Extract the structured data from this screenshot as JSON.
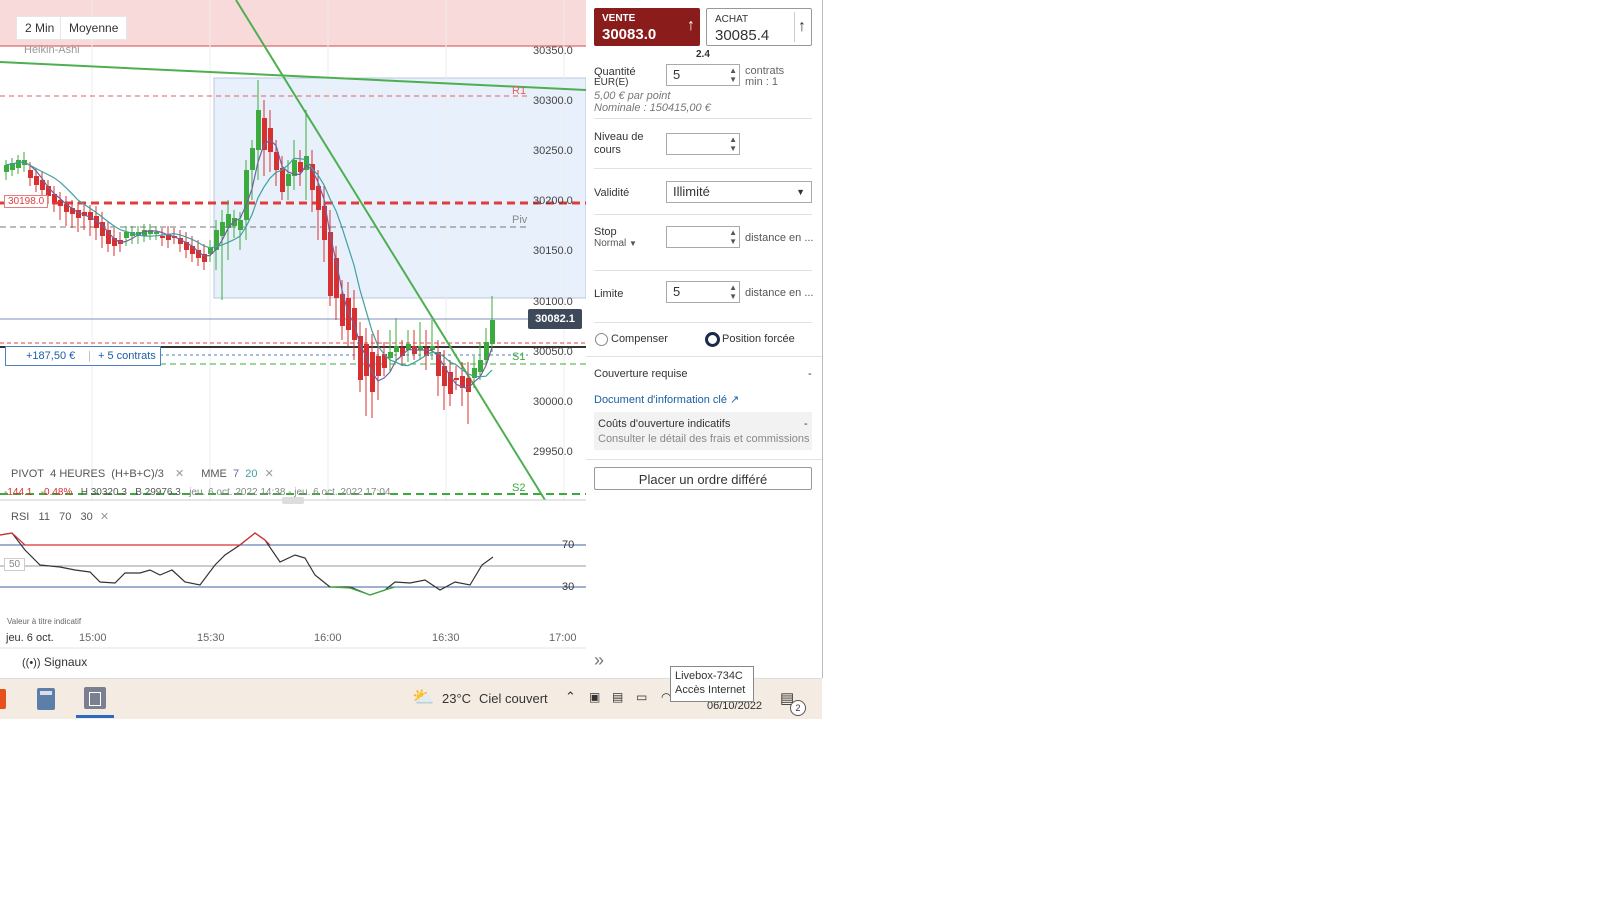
{
  "toolbar": {
    "timeframe": "2 Min",
    "average": "Moyenne",
    "chart_style": "Heikin-Ashi"
  },
  "chart": {
    "price_axis": [
      "30350.0",
      "30300.0",
      "30250.0",
      "30200.0",
      "30150.0",
      "30100.0",
      "30050.0",
      "30000.0",
      "29950.0"
    ],
    "current_price_tag": "30082.1",
    "level_tag": "30198.0",
    "level_labels": {
      "r1": "R1",
      "piv": "Piv",
      "s1": "S1",
      "s2": "S2"
    },
    "position_pnl": "+187,50 €",
    "position_contracts": "+ 5 contrats",
    "indicator_line1": {
      "pivot": "PIVOT",
      "period": "4 HEURES",
      "formula": "(H+B+C)/3",
      "mme": "MME",
      "mme_a": "7",
      "mme_b": "20"
    },
    "stats": {
      "change": "-144.1",
      "change_pct": "-0.48%",
      "high": "H 30320.3",
      "low": "B 29976.3",
      "range": "jeu. 6 oct. 2022 14:38 - jeu. 6 oct. 2022 17:04"
    },
    "rsi": {
      "label": "RSI",
      "p1": "11",
      "p2": "70",
      "p3": "30",
      "level_70": "70",
      "level_50": "50",
      "level_30": "30"
    },
    "disclaimer": "Valeur à titre indicatif",
    "time_axis": [
      "jeu. 6 oct.",
      "15:00",
      "15:30",
      "16:00",
      "16:30",
      "17:00"
    ],
    "signals": "Signaux"
  },
  "panel": {
    "sell_label": "VENTE",
    "sell_price": "30083.0",
    "buy_label": "ACHAT",
    "buy_price": "30085.4",
    "spread": "2.4",
    "quantity_label": "Quantité",
    "quantity_unit": "EUR(E)",
    "quantity_value": "5",
    "contracts_note": "contrats",
    "min_note": "min : 1",
    "per_point": "5,00 € par point",
    "nominal": "Nominale : 150415,00 €",
    "level_label": "Niveau de cours",
    "validity_label": "Validité",
    "validity_value": "Illimité",
    "stop_label": "Stop",
    "stop_type": "Normal",
    "stop_distance": "distance en ...",
    "limit_label": "Limite",
    "limit_value": "5",
    "limit_distance": "distance en ...",
    "radio_compensate": "Compenser",
    "radio_forced": "Position forcée",
    "margin_label": "Couverture requise",
    "margin_value": "-",
    "kid_link": "Document d'information clé",
    "costs_label": "Coûts d'ouverture indicatifs",
    "costs_value": "-",
    "costs_detail": "Consulter le détail des frais et commissions",
    "place_order": "Placer un ordre différé"
  },
  "taskbar": {
    "temperature": "23°C",
    "weather": "Ciel couvert",
    "date": "06/10/2022",
    "notif_count": "2",
    "tooltip_line1": "Livebox-734C",
    "tooltip_line2": "Accès Internet"
  },
  "colors": {
    "sell": "#8b1c1c",
    "up": "#3caa3c",
    "down": "#d83030",
    "accent": "#1a5fa8"
  }
}
